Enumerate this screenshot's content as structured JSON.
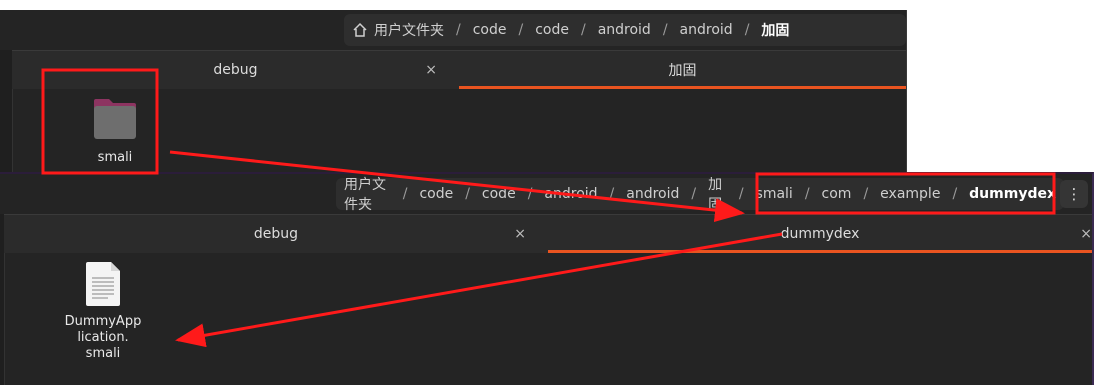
{
  "window_top": {
    "breadcrumbs": [
      "用户文件夹",
      "code",
      "code",
      "android",
      "android",
      "加固"
    ],
    "tabs": [
      {
        "label": "debug",
        "active": false,
        "close_glyph": "×"
      },
      {
        "label": "加固",
        "active": true
      }
    ],
    "files": [
      {
        "name": "smali",
        "icon": "folder-icon"
      }
    ]
  },
  "window_bottom": {
    "breadcrumbs": [
      "用户文件夹",
      "code",
      "code",
      "android",
      "android",
      "加固",
      "smali",
      "com",
      "example",
      "dummydex"
    ],
    "menu_glyph": "⋮",
    "tabs": [
      {
        "label": "debug",
        "active": false,
        "close_glyph": "×"
      },
      {
        "label": "dummydex",
        "active": true,
        "close_glyph": "×"
      }
    ],
    "files": [
      {
        "name_lines": [
          "DummyApp",
          "lication.",
          "smali"
        ],
        "icon": "text-file-icon"
      }
    ]
  },
  "colors": {
    "accent": "#e95420",
    "annotation": "#ff1a1a",
    "folder": "#6e6e6e",
    "folder_tab": "#8d3461"
  }
}
